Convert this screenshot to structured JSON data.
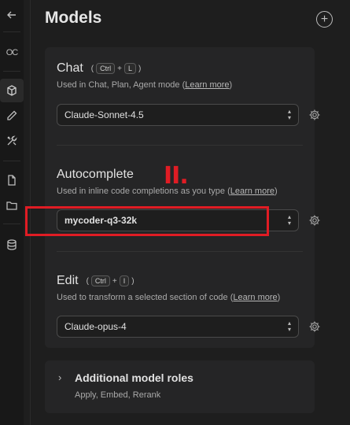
{
  "sidebar": {
    "items": [
      {
        "icon": "back-arrow-icon",
        "glyph": "←"
      },
      {
        "icon": "openclaw-logo-icon",
        "glyph": "OC"
      },
      {
        "icon": "cube-icon",
        "glyph": ""
      },
      {
        "icon": "pencil-icon",
        "glyph": ""
      },
      {
        "icon": "tools-icon",
        "glyph": ""
      },
      {
        "icon": "file-icon",
        "glyph": ""
      },
      {
        "icon": "folder-icon",
        "glyph": ""
      },
      {
        "icon": "database-icon",
        "glyph": ""
      }
    ]
  },
  "header": {
    "title": "Models",
    "add_icon": "+"
  },
  "chat": {
    "title": "Chat",
    "shortcut_open": "(",
    "key1": "Ctrl",
    "plus": "+",
    "key2": "L",
    "shortcut_close": ")",
    "desc": "Used in Chat, Plan, Agent mode (",
    "link": "Learn more",
    "desc_end": ")",
    "selected": "Claude-Sonnet-4.5"
  },
  "autocomplete": {
    "title": "Autocomplete",
    "desc": "Used in inline code completions as you type (",
    "link": "Learn more",
    "desc_end": ")",
    "selected": "mycoder-q3-32k"
  },
  "edit": {
    "title": "Edit",
    "shortcut_open": "(",
    "key1": "Ctrl",
    "plus": "+",
    "key2": "I",
    "shortcut_close": ")",
    "desc": "Used to transform a selected section of code (",
    "link": "Learn more",
    "desc_end": ")",
    "selected": "Claude-opus-4"
  },
  "annotation": {
    "label": "II."
  },
  "roles": {
    "chevron": "›",
    "title": "Additional model roles",
    "subtitle": "Apply, Embed, Rerank"
  },
  "colors": {
    "highlight": "#e01c24",
    "background": "#1e1e1e",
    "card": "#252526"
  }
}
